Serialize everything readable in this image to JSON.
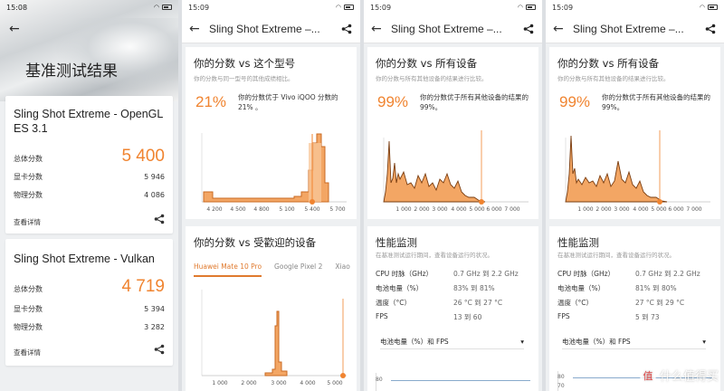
{
  "colors": {
    "accent": "#f08430",
    "chart_fill": "#f3a664"
  },
  "panel1": {
    "time": "15:08",
    "title": "基准测试结果",
    "cards": [
      {
        "name": "Sling Shot Extreme - OpenGL ES 3.1",
        "total_label": "总体分数",
        "total": "5 400",
        "gpu_label": "显卡分数",
        "gpu": "5 946",
        "phys_label": "物理分数",
        "phys": "4 086",
        "details": "查看详情"
      },
      {
        "name": "Sling Shot Extreme - Vulkan",
        "total_label": "总体分数",
        "total": "4 719",
        "gpu_label": "显卡分数",
        "gpu": "5 394",
        "phys_label": "物理分数",
        "phys": "3 282",
        "details": "查看详情"
      }
    ]
  },
  "panel2": {
    "time": "15:09",
    "title": "Sling Shot Extreme –...",
    "model_section": {
      "heading": "你的分数 vs 这个型号",
      "sub": "你的分数与同一型号的其他成绩相比。",
      "percent": "21%",
      "desc": "你的分数优于 Vivo iQOO 分数的 21% 。",
      "ticks": [
        "4 200",
        "4 500",
        "4 800",
        "5 100",
        "5 400",
        "5 700"
      ]
    },
    "popular_section": {
      "heading": "你的分数 vs 受歡迎的设备",
      "tabs": [
        "Huawei Mate 10 Pro",
        "Google Pixel 2",
        "Xiao"
      ],
      "ticks": [
        "1 000",
        "2 000",
        "3 000",
        "4 000",
        "5 000"
      ]
    }
  },
  "panel3": {
    "time": "15:09",
    "title": "Sling Shot Extreme –...",
    "all_section": {
      "heading": "你的分数 vs 所有设备",
      "sub": "你的分数与所有其他设备的结果进行比较。",
      "percent": "99%",
      "desc": "你的分数优于所有其他设备的结果的 99%。",
      "ticks": [
        "1 000",
        "2 000",
        "3 000",
        "4 000",
        "5 000",
        "6 000",
        "7 000"
      ]
    },
    "perf": {
      "heading": "性能监测",
      "sub": "在基准测试运行期间，查看设备运行的状况。",
      "rows": [
        {
          "k": "CPU 时脉（GHz）",
          "v": "0.7 GHz 到 2.2 GHz"
        },
        {
          "k": "电池电量（%）",
          "v": "83% 到 81%"
        },
        {
          "k": "温度（°C）",
          "v": "26 °C 到 27 °C"
        },
        {
          "k": "FPS",
          "v": "13 到 60"
        }
      ],
      "dropdown": "电池电量（%）和 FPS",
      "axis_top": "80"
    }
  },
  "panel4": {
    "time": "15:09",
    "title": "Sling Shot Extreme –...",
    "all_section": {
      "heading": "你的分数 vs 所有设备",
      "sub": "你的分数与所有其他设备的结果进行比较。",
      "percent": "99%",
      "desc": "你的分数优于所有其他设备的结果的 99%。",
      "ticks": [
        "1 000",
        "2 000",
        "3 000",
        "4 000",
        "5 000",
        "6 000",
        "7 000"
      ]
    },
    "perf": {
      "heading": "性能监测",
      "sub": "在基准测试运行期间，查看设备运行的状况。",
      "rows": [
        {
          "k": "CPU 时脉（GHz）",
          "v": "0.7 GHz 到 2.2 GHz"
        },
        {
          "k": "电池电量（%）",
          "v": "81% 到 80%"
        },
        {
          "k": "温度（°C）",
          "v": "27 °C 到 29 °C"
        },
        {
          "k": "FPS",
          "v": "5 到 73"
        }
      ],
      "dropdown": "电池电量（%）和 FPS",
      "axis_top": "80",
      "axis_second": "70"
    }
  },
  "watermark": {
    "badge": "值",
    "text": "什么值得买"
  }
}
